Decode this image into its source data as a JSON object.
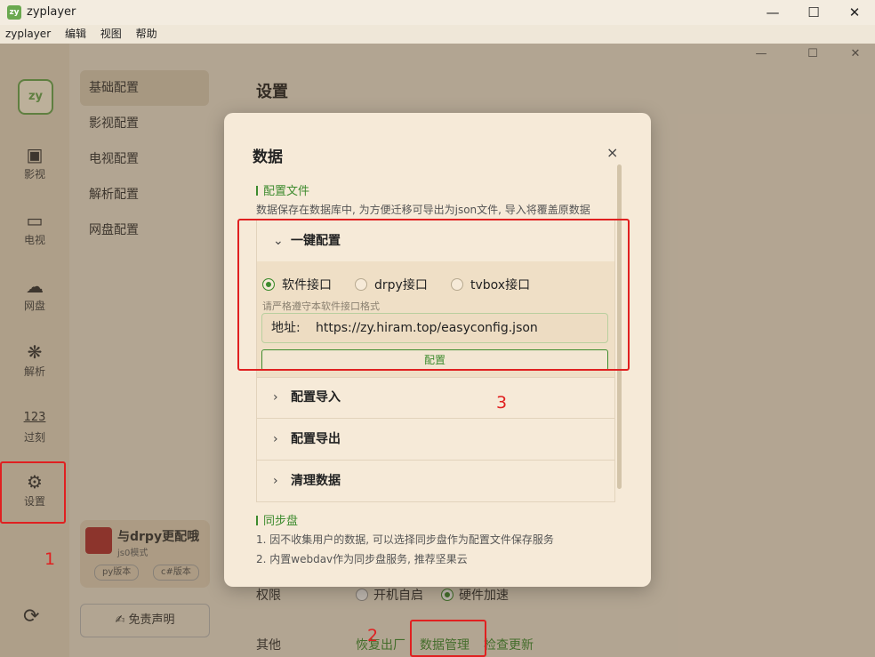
{
  "window": {
    "title": "zyplayer",
    "icon_text": "zy",
    "menu": [
      "zyplayer",
      "编辑",
      "视图",
      "帮助"
    ]
  },
  "nav": {
    "logo_text": "zy",
    "items": [
      {
        "label": "影视",
        "icon": "film-icon"
      },
      {
        "label": "电视",
        "icon": "tv-icon"
      },
      {
        "label": "网盘",
        "icon": "cloud-icon"
      },
      {
        "label": "解析",
        "icon": "cube-icon"
      },
      {
        "label": "过刻",
        "icon": "counter-icon"
      },
      {
        "label": "设置",
        "icon": "gear-icon"
      }
    ]
  },
  "subnav": {
    "items": [
      "基础配置",
      "影视配置",
      "电视配置",
      "解析配置",
      "网盘配置"
    ],
    "active": 0
  },
  "promo": {
    "title": "与drpy更配哦",
    "subtitle": "js0模式",
    "py_label": "py版本",
    "cs_label": "c#版本"
  },
  "disclaimer_label": "免责声明",
  "settings": {
    "title": "设置",
    "permission_label": "权限",
    "autostart_label": "开机自启",
    "hwaccel_label": "硬件加速",
    "other_label": "其他",
    "reset_label": "恢复出厂",
    "data_mgmt_label": "数据管理",
    "update_label": "检查更新"
  },
  "dialog": {
    "title": "数据",
    "close_label": "×",
    "section1_title": "配置文件",
    "section1_desc": "数据保存在数据库中, 为方便迁移可导出为json文件, 导入将覆盖原数据",
    "oneclick_title": "一键配置",
    "radios": [
      {
        "label": "软件接口",
        "selected": true
      },
      {
        "label": "drpy接口",
        "selected": false
      },
      {
        "label": "tvbox接口",
        "selected": false
      }
    ],
    "hint": "请严格遵守本软件接口格式",
    "address_label": "地址:",
    "address_value": "https://zy.hiram.top/easyconfig.json",
    "config_button": "配置",
    "import_title": "配置导入",
    "export_title": "配置导出",
    "clear_title": "清理数据",
    "section2_title": "同步盘",
    "section2_line1": "1. 因不收集用户的数据, 可以选择同步盘作为配置文件保存服务",
    "section2_line2": "2. 内置webdav作为同步盘服务, 推荐坚果云"
  },
  "annotations": {
    "n1": "1",
    "n2": "2",
    "n3": "3",
    "color": "#e02020"
  }
}
